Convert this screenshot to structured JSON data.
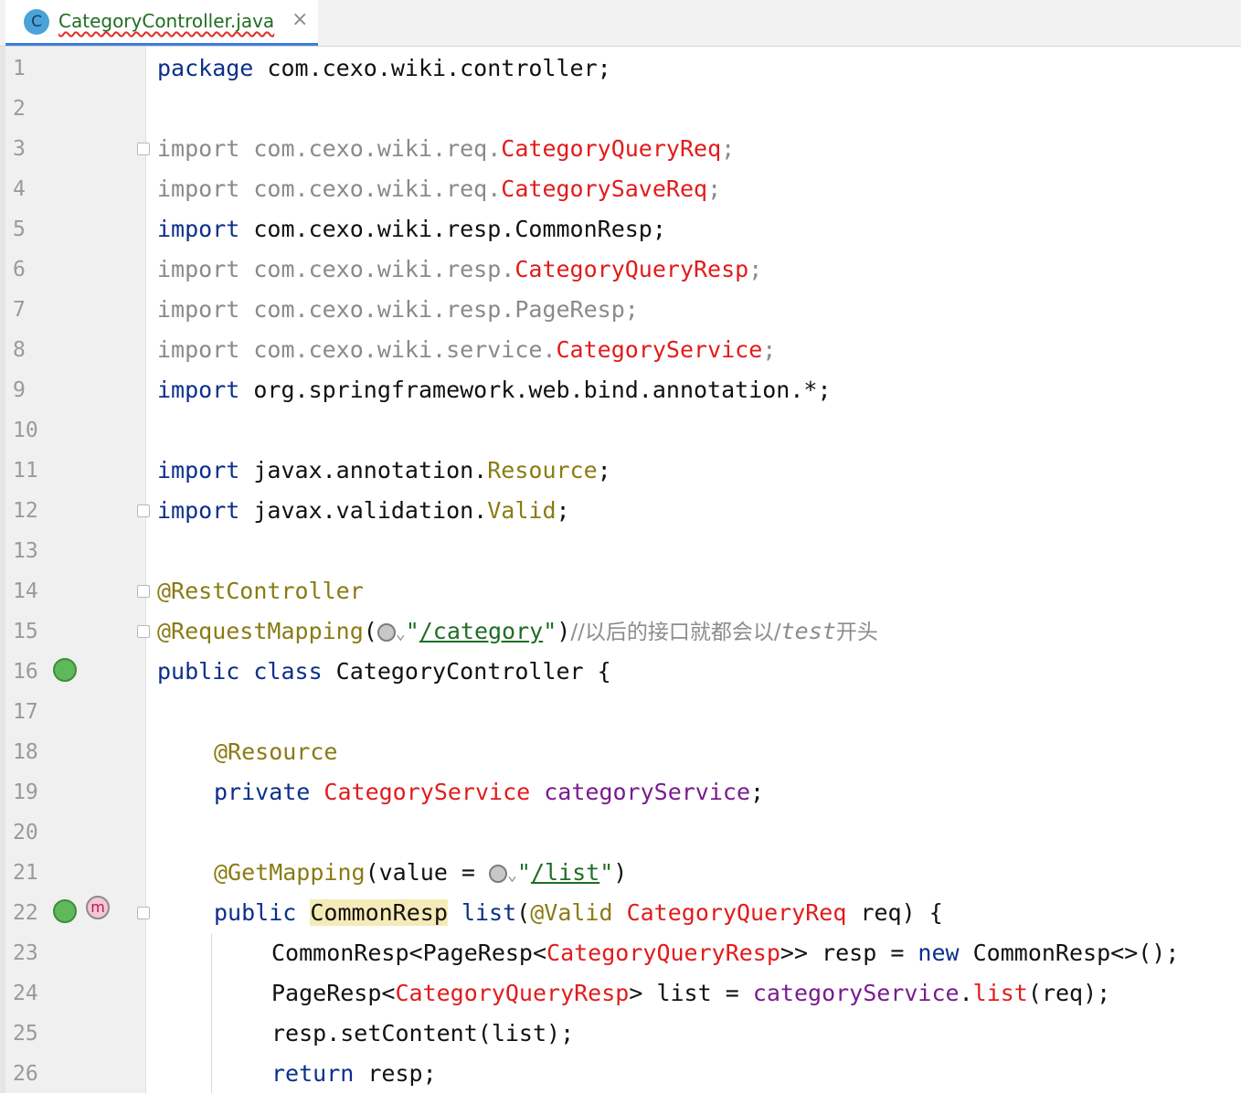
{
  "tab": {
    "icon_letter": "C",
    "title": "CategoryController.java",
    "close": "×"
  },
  "lines": [
    {
      "n": "1"
    },
    {
      "n": "2"
    },
    {
      "n": "3"
    },
    {
      "n": "4"
    },
    {
      "n": "5"
    },
    {
      "n": "6"
    },
    {
      "n": "7"
    },
    {
      "n": "8"
    },
    {
      "n": "9"
    },
    {
      "n": "10"
    },
    {
      "n": "11"
    },
    {
      "n": "12"
    },
    {
      "n": "13"
    },
    {
      "n": "14"
    },
    {
      "n": "15"
    },
    {
      "n": "16"
    },
    {
      "n": "17"
    },
    {
      "n": "18"
    },
    {
      "n": "19"
    },
    {
      "n": "20"
    },
    {
      "n": "21"
    },
    {
      "n": "22"
    },
    {
      "n": "23"
    },
    {
      "n": "24"
    },
    {
      "n": "25"
    },
    {
      "n": "26"
    }
  ],
  "code": {
    "l1": {
      "kw": "package",
      "rest": " com.cexo.wiki.controller;"
    },
    "l3": {
      "kw": "import",
      "pkg": " com.cexo.wiki.req.",
      "cls": "CategoryQueryReq",
      "end": ";"
    },
    "l4": {
      "kw": "import",
      "pkg": " com.cexo.wiki.req.",
      "cls": "CategorySaveReq",
      "end": ";"
    },
    "l5": {
      "kw": "import",
      "rest": " com.cexo.wiki.resp.CommonResp;"
    },
    "l6": {
      "kw": "import",
      "pkg": " com.cexo.wiki.resp.",
      "cls": "CategoryQueryResp",
      "end": ";"
    },
    "l7": {
      "kw": "import",
      "rest": " com.cexo.wiki.resp.PageResp;"
    },
    "l8": {
      "kw": "import",
      "pkg": " com.cexo.wiki.service.",
      "cls": "CategoryService",
      "end": ";"
    },
    "l9": {
      "kw": "import",
      "rest": " org.springframework.web.bind.annotation.*;"
    },
    "l11": {
      "kw": "import",
      "pkg": " javax.annotation.",
      "cls": "Resource",
      "end": ";"
    },
    "l12": {
      "kw": "import",
      "pkg": " javax.validation.",
      "cls": "Valid",
      "end": ";"
    },
    "l14": {
      "ann": "@RestController"
    },
    "l15": {
      "ann": "@RequestMapping",
      "open": "(",
      "q1": "\"",
      "path": "/category",
      "q2": "\"",
      "close": ")",
      "cmt": "//以后的接口就都会以/",
      "cmt_i": "test",
      "cmt2": "开头"
    },
    "l16": {
      "kw1": "public",
      "kw2": " class",
      "rest": " CategoryController {"
    },
    "l18": {
      "ann": "@Resource"
    },
    "l19": {
      "kw": "private",
      "type": " CategoryService",
      "fld": " categoryService",
      "end": ";"
    },
    "l21": {
      "ann": "@GetMapping",
      "args": "(value = ",
      "q1": "\"",
      "path": "/list",
      "q2": "\"",
      "close": ")"
    },
    "l22": {
      "kw": "public",
      "sp": " ",
      "type": "CommonResp",
      "method": " list",
      "open": "(",
      "ann": "@Valid",
      "ptype": " CategoryQueryReq",
      "rest": " req) {"
    },
    "l23": {
      "a": "CommonResp<PageResp<",
      "b": "CategoryQueryResp",
      "c": ">> resp = ",
      "kw": "new",
      "d": " CommonResp<>();"
    },
    "l24": {
      "a": "PageResp<",
      "b": "CategoryQueryResp",
      "c": "> list = ",
      "fld": "categoryService",
      "d": ".",
      "m": "list",
      "e": "(req);"
    },
    "l25": {
      "rest": "resp.setContent(list);"
    },
    "l26": {
      "kw": "return",
      "rest": " resp;"
    }
  },
  "gutter_icons": {
    "l16": "spring-bean-icon",
    "l22a": "spring-request-icon",
    "l22b": "method-m-icon",
    "l22b_letter": "m"
  },
  "colors": {
    "keyword": "#0b2f8a",
    "unresolved": "#e21b1b",
    "annotation": "#8a7b14",
    "field": "#7a1b8f",
    "string": "#1f6e24",
    "comment": "#8c8c8c",
    "highlight": "#f5ebb8"
  }
}
